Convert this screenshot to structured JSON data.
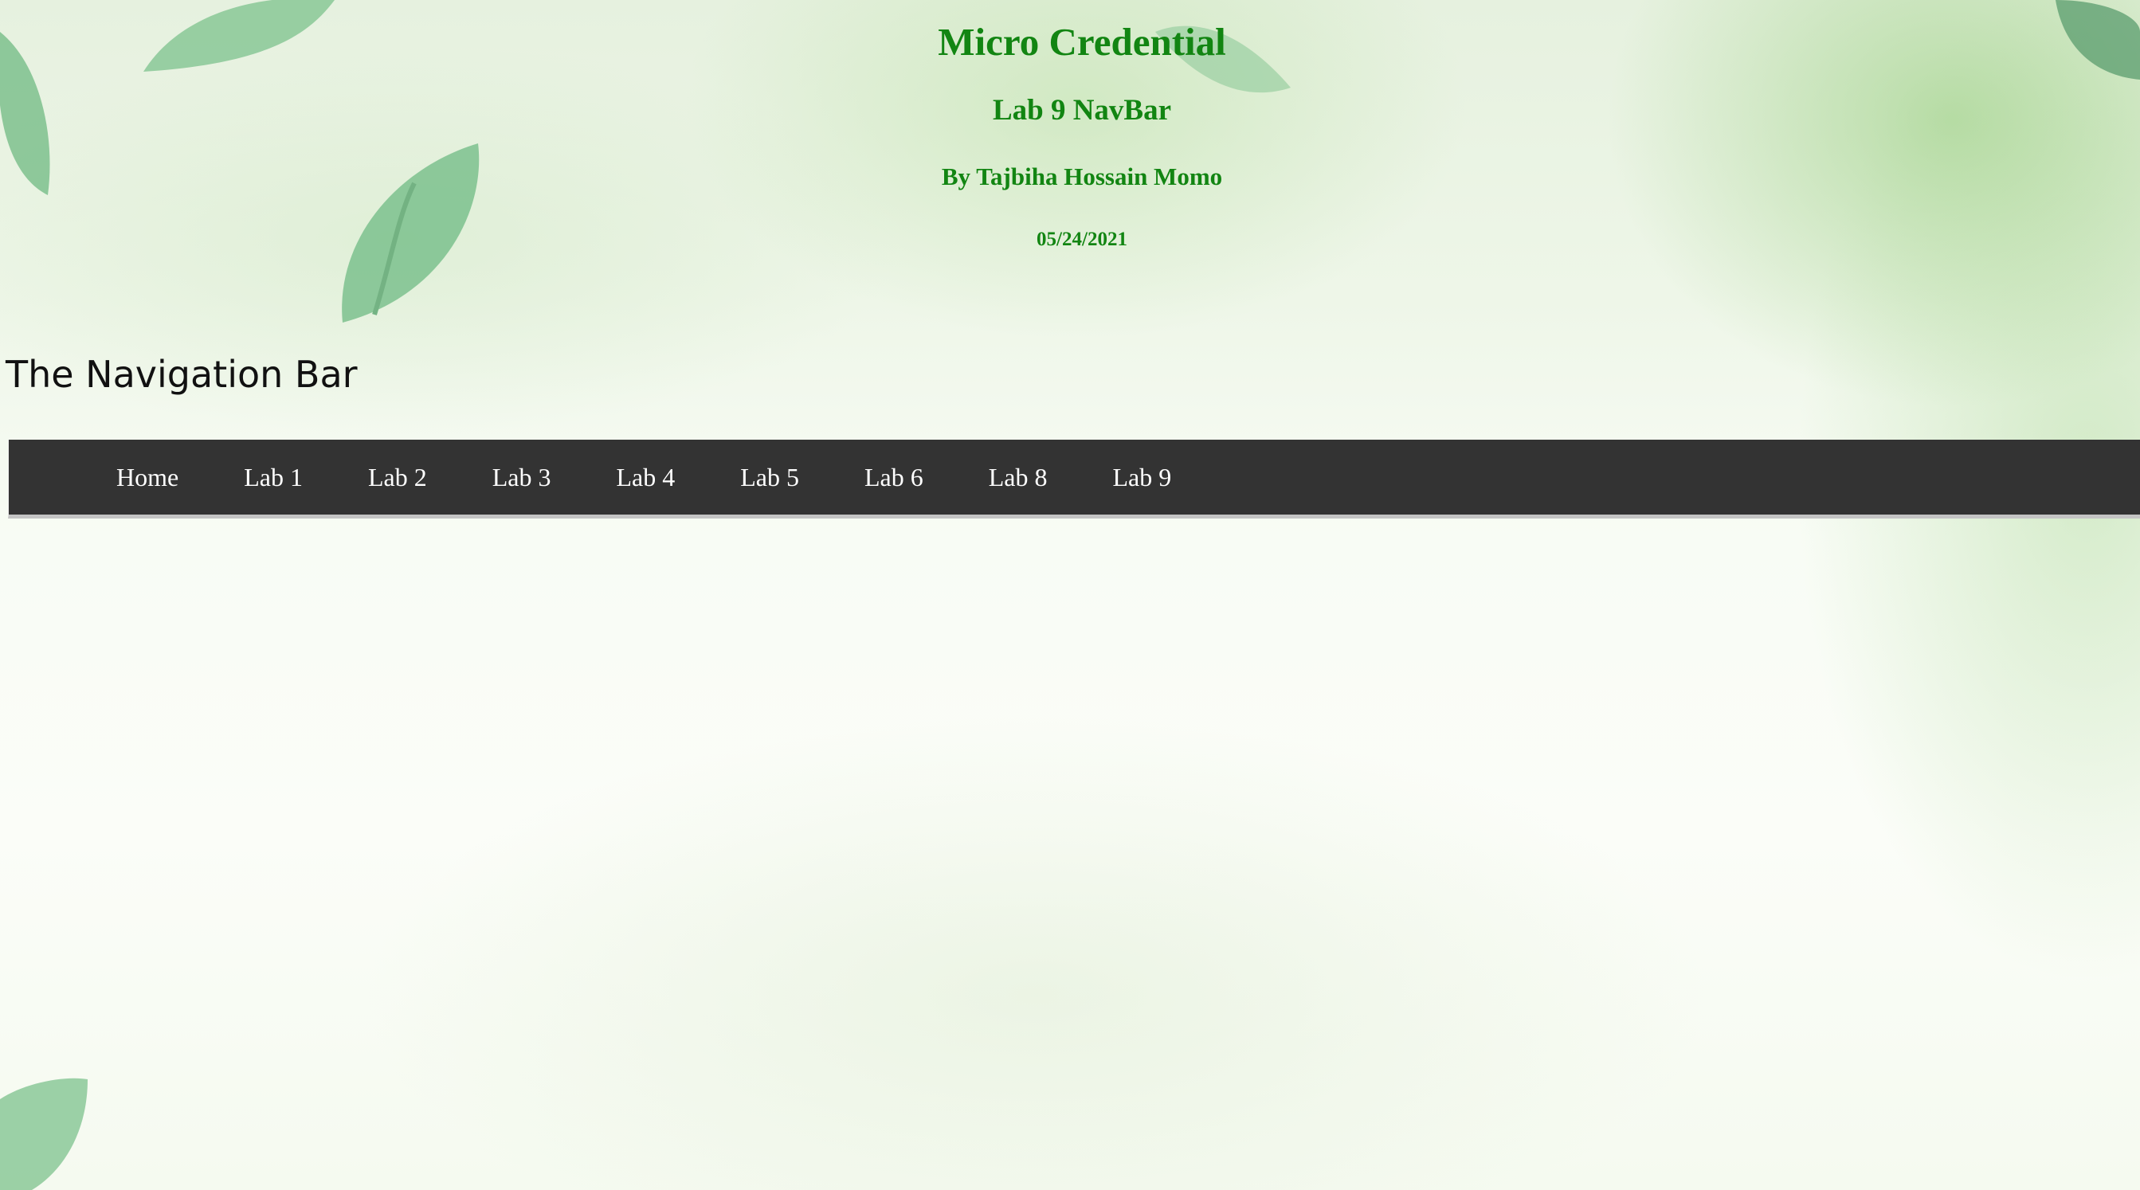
{
  "header": {
    "title": "Micro Credential",
    "subtitle": "Lab 9 NavBar",
    "author": "By Tajbiha Hossain Momo",
    "date": "05/24/2021"
  },
  "section": {
    "heading": "The Navigation Bar"
  },
  "navbar": {
    "items": [
      {
        "label": "Home"
      },
      {
        "label": "Lab 1"
      },
      {
        "label": "Lab 2"
      },
      {
        "label": "Lab 3"
      },
      {
        "label": "Lab 4"
      },
      {
        "label": "Lab 5"
      },
      {
        "label": "Lab 6"
      },
      {
        "label": "Lab 8"
      },
      {
        "label": "Lab 9"
      }
    ]
  },
  "colors": {
    "header_text": "#128512",
    "navbar_background": "#333333",
    "navbar_text": "#ffffff",
    "heading_text": "#111111"
  },
  "background": {
    "description_icon": "green-leaves-watercolor"
  }
}
